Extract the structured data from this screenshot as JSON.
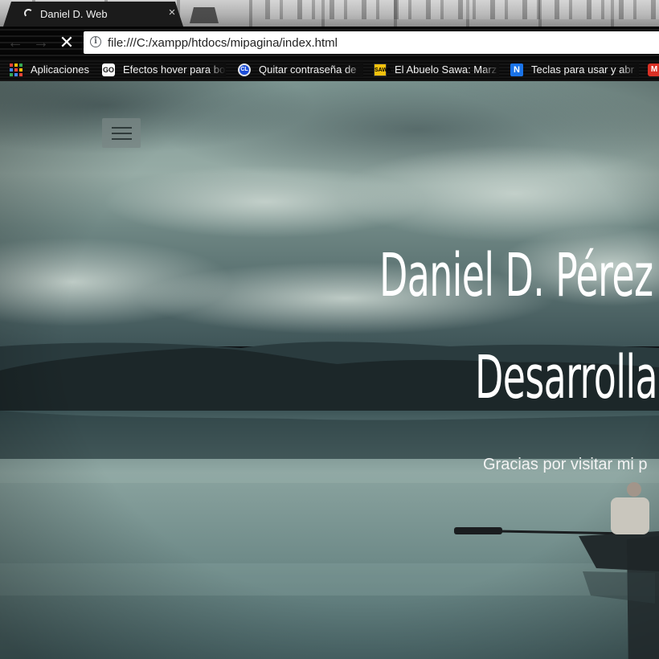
{
  "browser": {
    "tab": {
      "title": "Daniel D. Web",
      "close_glyph": "×",
      "loading": true
    },
    "nav": {
      "back_glyph": "←",
      "forward_glyph": "→",
      "stop_glyph": "✕"
    },
    "address_bar": {
      "info_glyph": "i",
      "url": "file:///C:/xampp/htdocs/mipagina/index.html"
    },
    "bookmarks": [
      {
        "label": "Aplicaciones",
        "icon": "apps-grid-icon"
      },
      {
        "label": "Efectos hover para bo",
        "icon": "go-favicon-icon"
      },
      {
        "label": "Quitar contraseña de",
        "icon": "cl-favicon-icon"
      },
      {
        "label": "El Abuelo Sawa: Marz",
        "icon": "sawa-favicon-icon"
      },
      {
        "label": "Teclas para usar y abr",
        "icon": "n-favicon-icon"
      },
      {
        "label": "",
        "icon": "m-favicon-icon"
      }
    ],
    "bookmark_glyphs": {
      "go": "GO",
      "cl": "CL",
      "sawa": "SAWA",
      "n": "N",
      "m": "M"
    }
  },
  "page": {
    "hero": {
      "name": "Daniel D. Pérez",
      "role": "Desarrollador",
      "tagline": "Gracias por visitar mi p"
    },
    "colors": {
      "sky_top": "#6f8a86",
      "water": "#5f7f80",
      "mountain": "#1e2a2c",
      "text": "#ffffff"
    }
  }
}
